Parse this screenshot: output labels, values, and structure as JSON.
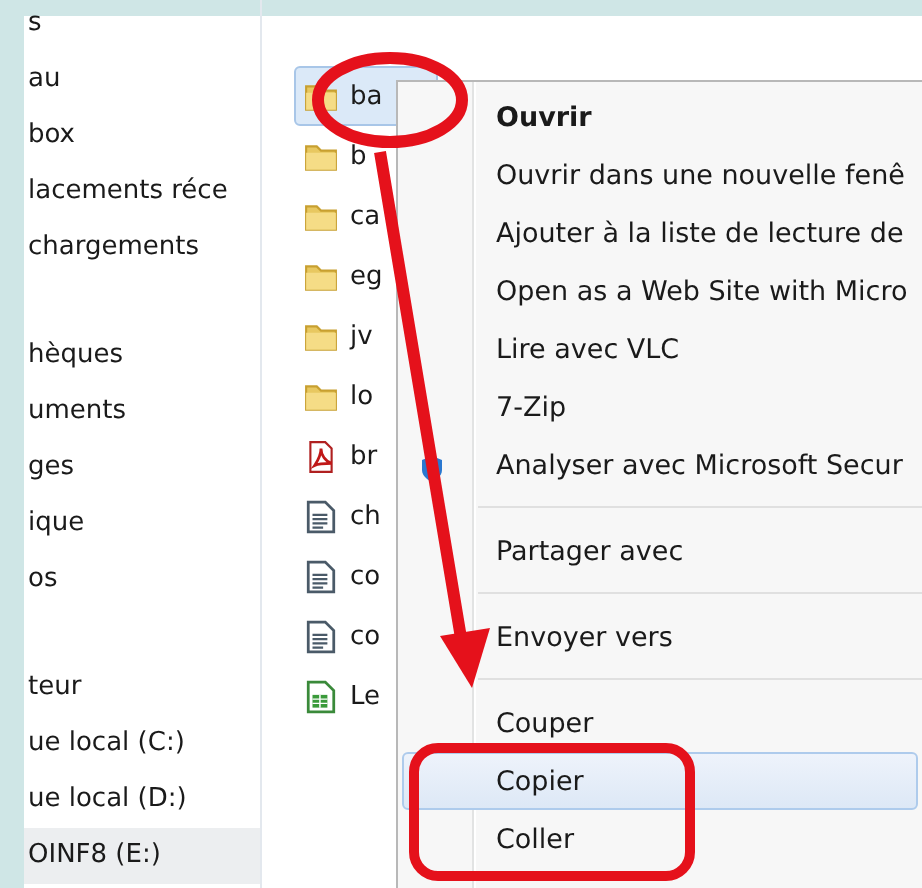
{
  "sidebar": {
    "groups": [
      [
        {
          "label": "s",
          "selected": false
        },
        {
          "label": "au",
          "selected": false
        },
        {
          "label": "box",
          "selected": false
        },
        {
          "label": "lacements réce",
          "selected": false
        },
        {
          "label": "chargements",
          "selected": false
        }
      ],
      [
        {
          "label": "hèques",
          "selected": false
        },
        {
          "label": "uments",
          "selected": false
        },
        {
          "label": "ges",
          "selected": false
        },
        {
          "label": "ique",
          "selected": false
        },
        {
          "label": "os",
          "selected": false
        }
      ],
      [
        {
          "label": "teur",
          "selected": false
        },
        {
          "label": "ue local (C:)",
          "selected": false
        },
        {
          "label": "ue local (D:)",
          "selected": false
        },
        {
          "label": "OINF8 (E:)",
          "selected": true
        }
      ]
    ]
  },
  "files": [
    {
      "name": "ba",
      "kind": "folder",
      "selected": true
    },
    {
      "name": "b",
      "kind": "folder",
      "selected": false
    },
    {
      "name": "ca",
      "kind": "folder",
      "selected": false
    },
    {
      "name": "eg",
      "kind": "folder",
      "selected": false
    },
    {
      "name": "jv",
      "kind": "folder",
      "selected": false
    },
    {
      "name": "lo",
      "kind": "folder",
      "selected": false
    },
    {
      "name": "br",
      "kind": "pdf",
      "selected": false
    },
    {
      "name": "ch",
      "kind": "document",
      "selected": false
    },
    {
      "name": "co",
      "kind": "document",
      "selected": false
    },
    {
      "name": "co",
      "kind": "document",
      "selected": false
    },
    {
      "name": "Le",
      "kind": "spreadsheet",
      "selected": false
    }
  ],
  "context_menu": {
    "groups": [
      [
        {
          "label": "Ouvrir",
          "kind": "default",
          "selected": false
        },
        {
          "label": "Ouvrir dans une nouvelle fenê",
          "kind": "plain",
          "selected": false
        },
        {
          "label": "Ajouter à la liste de lecture de",
          "kind": "plain",
          "selected": false
        },
        {
          "label": "Open as a Web Site with Micro",
          "kind": "plain",
          "selected": false
        },
        {
          "label": "Lire avec VLC",
          "kind": "plain",
          "selected": false
        },
        {
          "label": "7-Zip",
          "kind": "plain",
          "selected": false
        },
        {
          "label": "Analyser avec Microsoft Secur",
          "kind": "with_icon",
          "selected": false
        }
      ],
      [
        {
          "label": "Partager avec",
          "kind": "plain",
          "selected": false
        }
      ],
      [
        {
          "label": "Envoyer vers",
          "kind": "plain",
          "selected": false
        }
      ],
      [
        {
          "label": "Couper",
          "kind": "plain",
          "selected": false
        },
        {
          "label": "Copier",
          "kind": "plain",
          "selected": true
        },
        {
          "label": "Coller",
          "kind": "plain",
          "selected": false
        }
      ]
    ]
  },
  "annotations": [
    {
      "kind": "ellipse"
    },
    {
      "kind": "arrow"
    },
    {
      "kind": "rectangle"
    }
  ]
}
